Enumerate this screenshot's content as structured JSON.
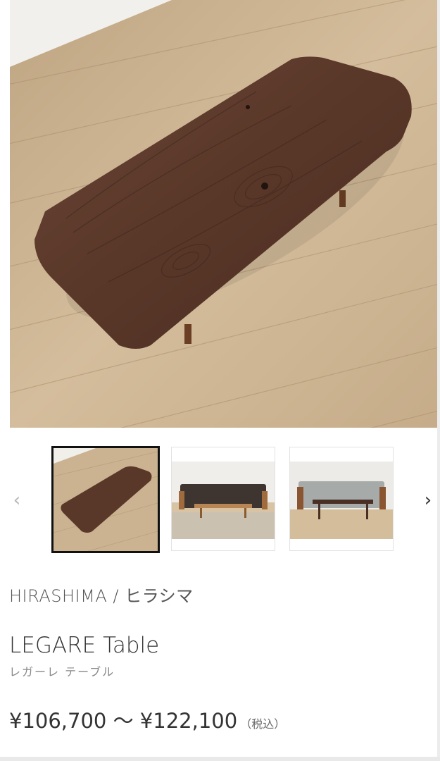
{
  "gallery": {
    "prev_icon": "chevron-left-icon",
    "next_icon": "chevron-right-icon",
    "prev_glyph": "‹",
    "next_glyph": "›",
    "thumbnails": [
      {
        "alt": "",
        "selected": true
      },
      {
        "alt": "",
        "selected": false
      },
      {
        "alt": "",
        "selected": false
      }
    ]
  },
  "product": {
    "brand": "HIRASHIMA / ヒラシマ",
    "name": "LEGARE Table",
    "name_kana": "レガーレ テーブル",
    "price_range": "¥106,700 〜 ¥122,100",
    "tax_note": "（税込）"
  },
  "colors": {
    "walnut": "#5a3a2c",
    "floor": "#c9b08f",
    "selected_border": "#111111"
  }
}
